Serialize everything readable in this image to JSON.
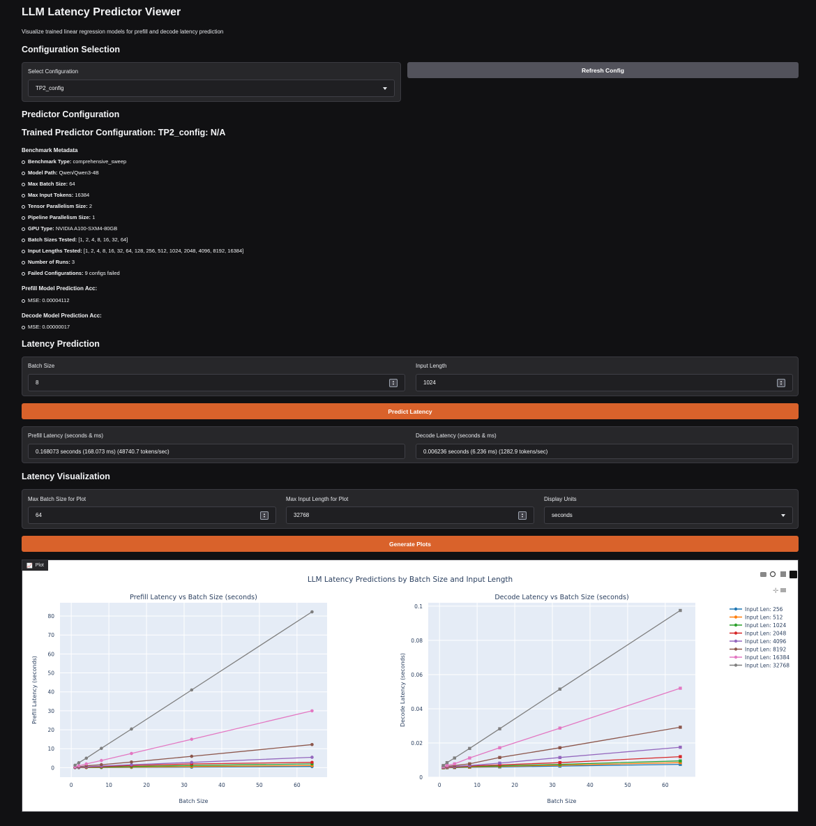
{
  "app": {
    "title": "LLM Latency Predictor Viewer",
    "subtitle": "Visualize trained linear regression models for prefill and decode latency prediction"
  },
  "config_section": {
    "title": "Configuration Selection",
    "select_label": "Select Configuration",
    "selected_value": "TP2_config",
    "refresh_button": "Refresh Config"
  },
  "predictor": {
    "title": "Predictor Configuration",
    "trained_title": "Trained Predictor Configuration: TP2_config: N/A",
    "metadata_heading": "Benchmark Metadata",
    "metadata": [
      {
        "key": "Benchmark Type:",
        "value": " comprehensive_sweep"
      },
      {
        "key": "Model Path:",
        "value": " Qwen/Qwen3-4B"
      },
      {
        "key": "Max Batch Size:",
        "value": " 64"
      },
      {
        "key": "Max Input Tokens:",
        "value": " 16384"
      },
      {
        "key": "Tensor Parallelism Size:",
        "value": " 2"
      },
      {
        "key": "Pipeline Parallelism Size:",
        "value": " 1"
      },
      {
        "key": "GPU Type:",
        "value": " NVIDIA A100-SXM4-80GB"
      },
      {
        "key": "Batch Sizes Tested:",
        "value": " [1, 2, 4, 8, 16, 32, 64]"
      },
      {
        "key": "Input Lengths Tested:",
        "value": " [1, 2, 4, 8, 16, 32, 64, 128, 256, 512, 1024, 2048, 4096, 8192, 16384]"
      },
      {
        "key": "Number of Runs:",
        "value": " 3"
      },
      {
        "key": "Failed Configurations:",
        "value": " 9 configs failed"
      }
    ],
    "prefill_acc_heading": "Prefill Model Prediction Acc:",
    "prefill_mse": "MSE: 0.00004112",
    "decode_acc_heading": "Decode Model Prediction Acc:",
    "decode_mse": "MSE: 0.00000017"
  },
  "prediction": {
    "title": "Latency Prediction",
    "batch_label": "Batch Size",
    "batch_value": "8",
    "input_label": "Input Length",
    "input_value": "1024",
    "predict_button": "Predict Latency",
    "prefill_label": "Prefill Latency (seconds & ms)",
    "prefill_value": "0.168073 seconds (168.073 ms) (48740.7 tokens/sec)",
    "decode_label": "Decode Latency (seconds & ms)",
    "decode_value": "0.006236 seconds (6.236 ms) (1282.9 tokens/sec)"
  },
  "visualization": {
    "title": "Latency Visualization",
    "max_batch_label": "Max Batch Size for Plot",
    "max_batch_value": "64",
    "max_input_label": "Max Input Length for Plot",
    "max_input_value": "32768",
    "units_label": "Display Units",
    "units_value": "seconds",
    "generate_button": "Generate Plots",
    "plot_tab_label": "Plot",
    "plot_title": "LLM Latency Predictions by Batch Size and Input Length"
  },
  "colors": {
    "accent": "#d9622b",
    "panel": "#27272a",
    "background": "#111113",
    "plot_bg": "#e5ecf6"
  },
  "chart_data": [
    {
      "type": "line",
      "title": "Prefill Latency vs Batch Size (seconds)",
      "xlabel": "Batch Size",
      "ylabel": "Prefill Latency (seconds)",
      "xlim": [
        -3,
        68
      ],
      "ylim": [
        -5,
        87
      ],
      "xticks": [
        0,
        10,
        20,
        30,
        40,
        50,
        60
      ],
      "yticks": [
        0,
        10,
        20,
        30,
        40,
        50,
        60,
        70,
        80
      ],
      "marker": "circle",
      "x": [
        1,
        2,
        4,
        8,
        16,
        32,
        64
      ],
      "series": [
        {
          "name": "Input Len: 256",
          "color": "#1f77b4",
          "values": [
            0.01,
            0.02,
            0.04,
            0.08,
            0.15,
            0.3,
            0.6
          ]
        },
        {
          "name": "Input Len: 512",
          "color": "#ff7f0e",
          "values": [
            0.02,
            0.04,
            0.08,
            0.16,
            0.3,
            0.6,
            1.1
          ]
        },
        {
          "name": "Input Len: 1024",
          "color": "#2ca02c",
          "values": [
            0.04,
            0.08,
            0.15,
            0.3,
            0.6,
            1.2,
            2.0
          ]
        },
        {
          "name": "Input Len: 2048",
          "color": "#d62728",
          "values": [
            0.08,
            0.15,
            0.3,
            0.6,
            1.1,
            2.0,
            2.8
          ]
        },
        {
          "name": "Input Len: 4096",
          "color": "#9467bd",
          "values": [
            0.1,
            0.2,
            0.5,
            0.9,
            1.6,
            2.8,
            5.5
          ]
        },
        {
          "name": "Input Len: 8192",
          "color": "#8c564b",
          "values": [
            0.3,
            0.5,
            1.0,
            1.6,
            3.0,
            6.0,
            12.2
          ]
        },
        {
          "name": "Input Len: 16384",
          "color": "#e377c2",
          "values": [
            0.5,
            1.0,
            2.0,
            3.8,
            7.5,
            15.0,
            30.0
          ]
        },
        {
          "name": "Input Len: 32768",
          "color": "#7f7f7f",
          "values": [
            1.3,
            2.6,
            5.0,
            10.2,
            20.4,
            41.0,
            82.2
          ]
        }
      ]
    },
    {
      "type": "line",
      "title": "Decode Latency vs Batch Size (seconds)",
      "xlabel": "Batch Size",
      "ylabel": "Decode Latency (seconds)",
      "xlim": [
        -3,
        68
      ],
      "ylim": [
        0,
        0.102
      ],
      "xticks": [
        0,
        10,
        20,
        30,
        40,
        50,
        60
      ],
      "yticks": [
        0,
        0.02,
        0.04,
        0.06,
        0.08,
        0.1
      ],
      "ytick_labels": [
        "0",
        "0.02",
        "0.04",
        "0.06",
        "0.08",
        "0.1"
      ],
      "marker": "square",
      "x": [
        1,
        2,
        4,
        8,
        16,
        32,
        64
      ],
      "series": [
        {
          "name": "Input Len: 256",
          "color": "#1f77b4",
          "values": [
            0.0055,
            0.0055,
            0.0056,
            0.0058,
            0.006,
            0.0065,
            0.0075
          ]
        },
        {
          "name": "Input Len: 512",
          "color": "#ff7f0e",
          "values": [
            0.0055,
            0.0056,
            0.0057,
            0.0059,
            0.0063,
            0.007,
            0.0085
          ]
        },
        {
          "name": "Input Len: 1024",
          "color": "#2ca02c",
          "values": [
            0.0056,
            0.0057,
            0.0058,
            0.0062,
            0.0066,
            0.0075,
            0.0095
          ]
        },
        {
          "name": "Input Len: 2048",
          "color": "#d62728",
          "values": [
            0.0057,
            0.0058,
            0.006,
            0.0065,
            0.0072,
            0.0085,
            0.012
          ]
        },
        {
          "name": "Input Len: 4096",
          "color": "#9467bd",
          "values": [
            0.0058,
            0.006,
            0.0063,
            0.0068,
            0.0082,
            0.0115,
            0.0175
          ]
        },
        {
          "name": "Input Len: 8192",
          "color": "#8c564b",
          "values": [
            0.006,
            0.0063,
            0.0068,
            0.0078,
            0.0115,
            0.0172,
            0.0292
          ]
        },
        {
          "name": "Input Len: 16384",
          "color": "#e377c2",
          "values": [
            0.0062,
            0.0068,
            0.0078,
            0.0112,
            0.0172,
            0.0287,
            0.052
          ]
        },
        {
          "name": "Input Len: 32768",
          "color": "#7f7f7f",
          "values": [
            0.0068,
            0.0085,
            0.0112,
            0.0168,
            0.0283,
            0.0515,
            0.0975
          ]
        }
      ]
    }
  ]
}
